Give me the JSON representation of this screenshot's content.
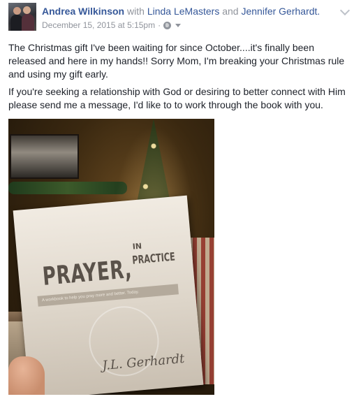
{
  "post": {
    "author": "Andrea Wilkinson",
    "with_word": "with",
    "tagged_1": "Linda LeMasters",
    "and_word": "and",
    "tagged_2": "Jennifer Gerhardt",
    "timestamp": "December 15, 2015 at 5:15pm",
    "separator": "·",
    "audience_icon": "globe-icon",
    "paragraph_1": "The Christmas gift I've been waiting for since October....it's finally been released and here in my hands!! Sorry Mom, I'm breaking your Christmas rule and using my gift early.",
    "paragraph_2": "If you're seeking a relationship with God or desiring to better connect with Him please send me a message, I'd like to to work through the book with you."
  },
  "photo": {
    "book_title": "PRAYER,",
    "book_title_small": "IN",
    "book_title_practice": "PRACTICE",
    "book_subtitle": "A workbook to help you pray more and better. Today.",
    "book_author": "J.L. Gerhardt"
  },
  "colors": {
    "link": "#365899",
    "meta": "#90949c",
    "text": "#1d2129"
  }
}
